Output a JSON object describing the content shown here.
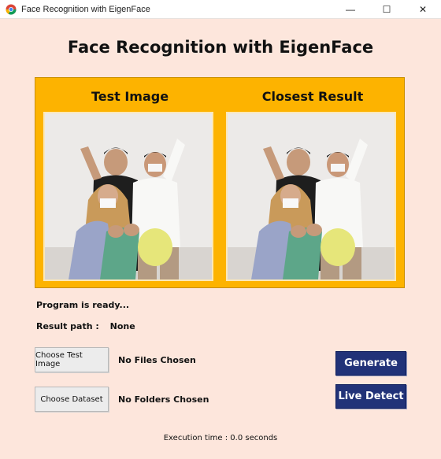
{
  "window": {
    "title": "Face Recognition with EigenFace",
    "controls": {
      "minimize": "—",
      "maximize": "☐",
      "close": "✕"
    }
  },
  "heading": "Face Recognition with EigenFace",
  "panel": {
    "left_label": "Test Image",
    "right_label": "Closest Result",
    "background": "#fdb300"
  },
  "status": {
    "message": "Program is ready..."
  },
  "result": {
    "label": "Result path :",
    "value": "None"
  },
  "controls": {
    "choose_test_image": "Choose Test Image",
    "test_image_status": "No Files Chosen",
    "choose_dataset": "Choose Dataset",
    "dataset_status": "No Folders Chosen",
    "generate": "Generate",
    "live_detect": "Live Detect"
  },
  "footer": {
    "execution_time": "Execution time : 0.0 seconds"
  },
  "colors": {
    "accent_dark": "#213278",
    "window_bg": "#fde6dc"
  }
}
